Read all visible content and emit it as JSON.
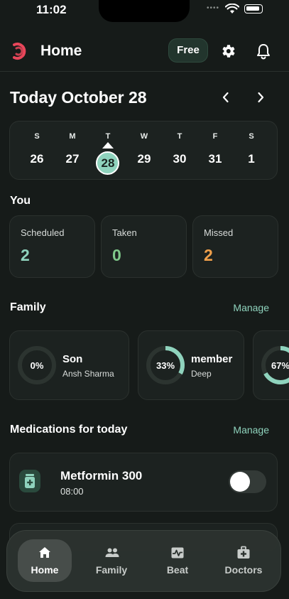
{
  "status_bar": {
    "time": "11:02",
    "dots": "••••"
  },
  "header": {
    "title": "Home",
    "free_label": "Free"
  },
  "date_header": {
    "title": "Today October 28"
  },
  "week": {
    "days": [
      {
        "letter": "S",
        "number": "26"
      },
      {
        "letter": "M",
        "number": "27"
      },
      {
        "letter": "T",
        "number": "28",
        "selected": true
      },
      {
        "letter": "W",
        "number": "29"
      },
      {
        "letter": "T",
        "number": "30"
      },
      {
        "letter": "F",
        "number": "31"
      },
      {
        "letter": "S",
        "number": "1"
      }
    ]
  },
  "you": {
    "title": "You",
    "stats": [
      {
        "label": "Scheduled",
        "value": "2",
        "color": "#8fd3bd"
      },
      {
        "label": "Taken",
        "value": "0",
        "color": "#7fc98a"
      },
      {
        "label": "Missed",
        "value": "2",
        "color": "#f0a04b"
      }
    ]
  },
  "family": {
    "title": "Family",
    "manage_label": "Manage",
    "members": [
      {
        "percent": "0%",
        "progress": 0,
        "name": "Son",
        "sub": "Ansh Sharma"
      },
      {
        "percent": "33%",
        "progress": 0.33,
        "name": "member",
        "sub": "Deep"
      },
      {
        "percent": "67%",
        "progress": 0.67,
        "name": "",
        "sub": ""
      }
    ]
  },
  "medications": {
    "title": "Medications for today",
    "manage_label": "Manage",
    "items": [
      {
        "name": "Metformin 300",
        "time": "08:00",
        "enabled": false
      }
    ]
  },
  "nav": {
    "items": [
      {
        "label": "Home",
        "icon": "home-icon",
        "active": true
      },
      {
        "label": "Family",
        "icon": "people-icon"
      },
      {
        "label": "Beat",
        "icon": "pulse-icon"
      },
      {
        "label": "Doctors",
        "icon": "doctor-bag-icon"
      }
    ]
  },
  "colors": {
    "accent": "#8fd3bd",
    "background": "#161b19",
    "card": "#1c2220",
    "logo": "#e8465a"
  }
}
